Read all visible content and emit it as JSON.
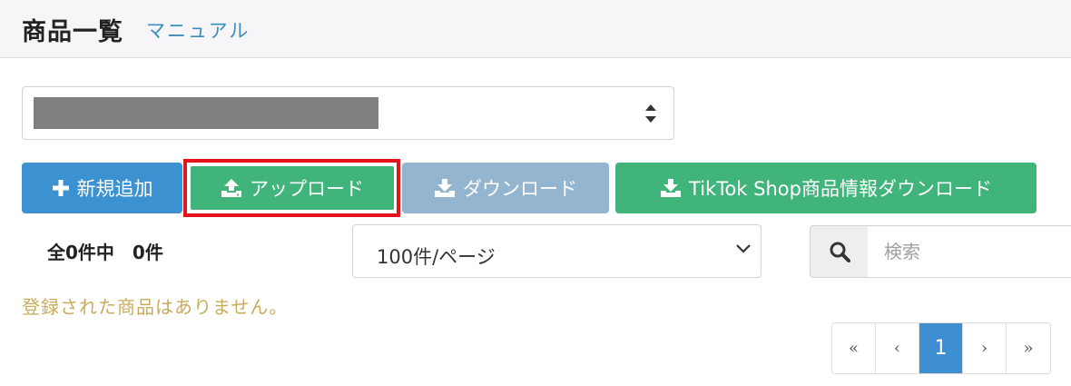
{
  "header": {
    "title": "商品一覧",
    "manual_link": "マニュアル"
  },
  "store_selector": {
    "value_redacted": true
  },
  "toolbar": {
    "add_label": "新規追加",
    "upload_label": "アップロード",
    "download_label": "ダウンロード",
    "tiktok_download_label": "TikTok Shop商品情報ダウンロード"
  },
  "summary": {
    "count_text": "全0件中　0件"
  },
  "per_page": {
    "selected": "100件/ページ"
  },
  "search": {
    "placeholder": "検索",
    "value": ""
  },
  "empty_message": "登録された商品はありません。",
  "pagination": {
    "first": "«",
    "prev": "‹",
    "current": "1",
    "next": "›",
    "last": "»"
  },
  "colors": {
    "primary_blue": "#3c91d0",
    "green": "#41b47c",
    "disabled_blue": "#93b5cf",
    "highlight_red": "#e3151b",
    "warning_text": "#c8ac5a"
  },
  "icons": [
    "plus-icon",
    "upload-icon",
    "download-icon",
    "search-icon",
    "sort-updown-icon",
    "chevron-down-icon"
  ]
}
